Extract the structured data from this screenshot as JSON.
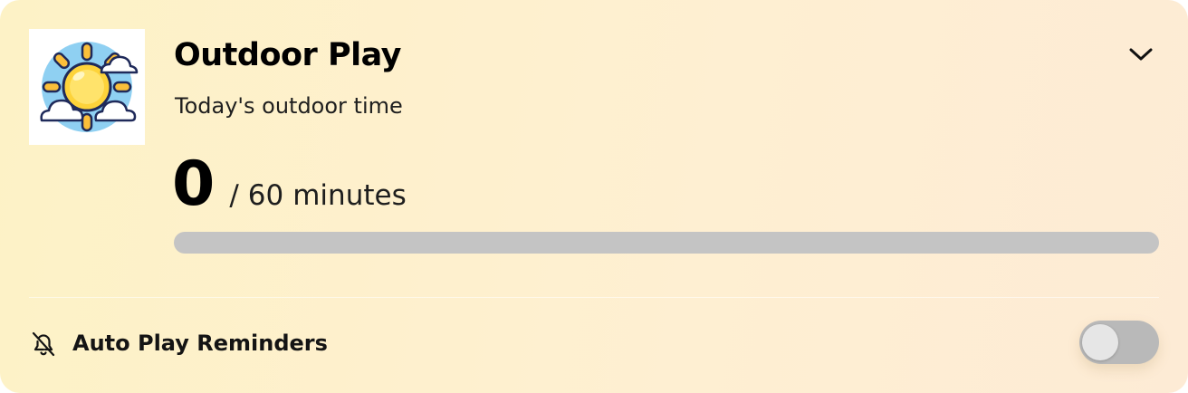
{
  "card": {
    "title": "Outdoor Play",
    "subtitle": "Today's outdoor time",
    "icon": "sun-with-clouds-icon",
    "expand_icon": "chevron-down-icon"
  },
  "progress": {
    "current": "0",
    "separator": "/",
    "goal": "60",
    "unit": "minutes",
    "fraction": 0
  },
  "reminders": {
    "label": "Auto Play Reminders",
    "icon": "bell-off-icon",
    "enabled": false
  },
  "colors": {
    "card_bg": "#fdf2c6",
    "track": "#c4c4c4",
    "toggle_off": "#b9b9b9",
    "sun": "#fdd33a",
    "sky": "#8fd0f2"
  }
}
